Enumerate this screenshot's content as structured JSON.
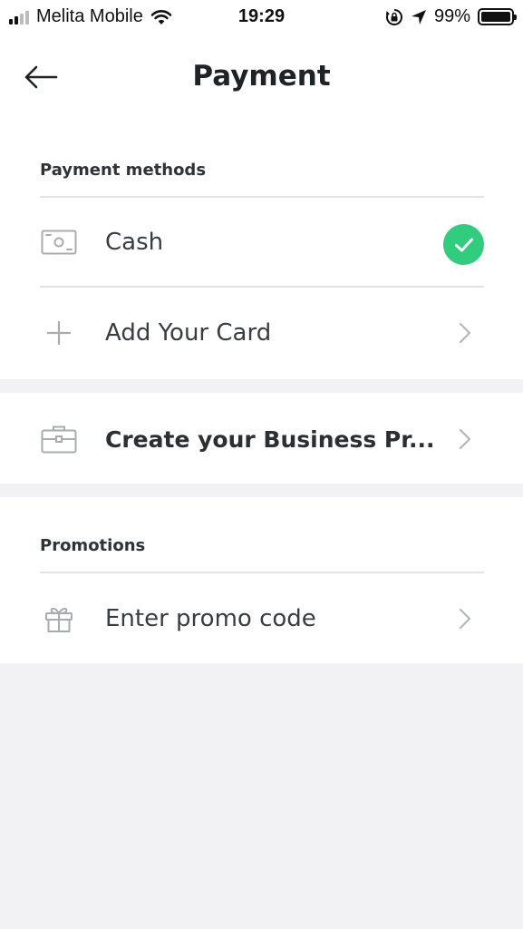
{
  "status_bar": {
    "carrier": "Melita Mobile",
    "time": "19:29",
    "battery": "99%",
    "battery_level": 0.99,
    "icons": [
      "signal-icon",
      "wifi-icon",
      "rotation-lock-icon",
      "location-arrow-icon",
      "battery-icon"
    ]
  },
  "header": {
    "title": "Payment",
    "back_icon": "arrow-left-icon"
  },
  "payment_methods": {
    "label": "Payment methods",
    "items": [
      {
        "label": "Cash",
        "icon": "cash-icon",
        "selected": true,
        "selected_icon": "checkmark-icon"
      },
      {
        "label": "Add Your Card",
        "icon": "plus-icon",
        "trailing_icon": "chevron-right-icon"
      }
    ]
  },
  "business": {
    "label": "Create your Business Pr...",
    "icon": "briefcase-icon",
    "trailing_icon": "chevron-right-icon"
  },
  "promotions": {
    "label": "Promotions",
    "items": [
      {
        "label": "Enter promo code",
        "icon": "gift-icon",
        "trailing_icon": "chevron-right-icon"
      }
    ]
  },
  "colors": {
    "accent_green": "#31cc7d",
    "background": "#f2f2f4",
    "card": "#ffffff",
    "icon_gray": "#a9abaf"
  }
}
